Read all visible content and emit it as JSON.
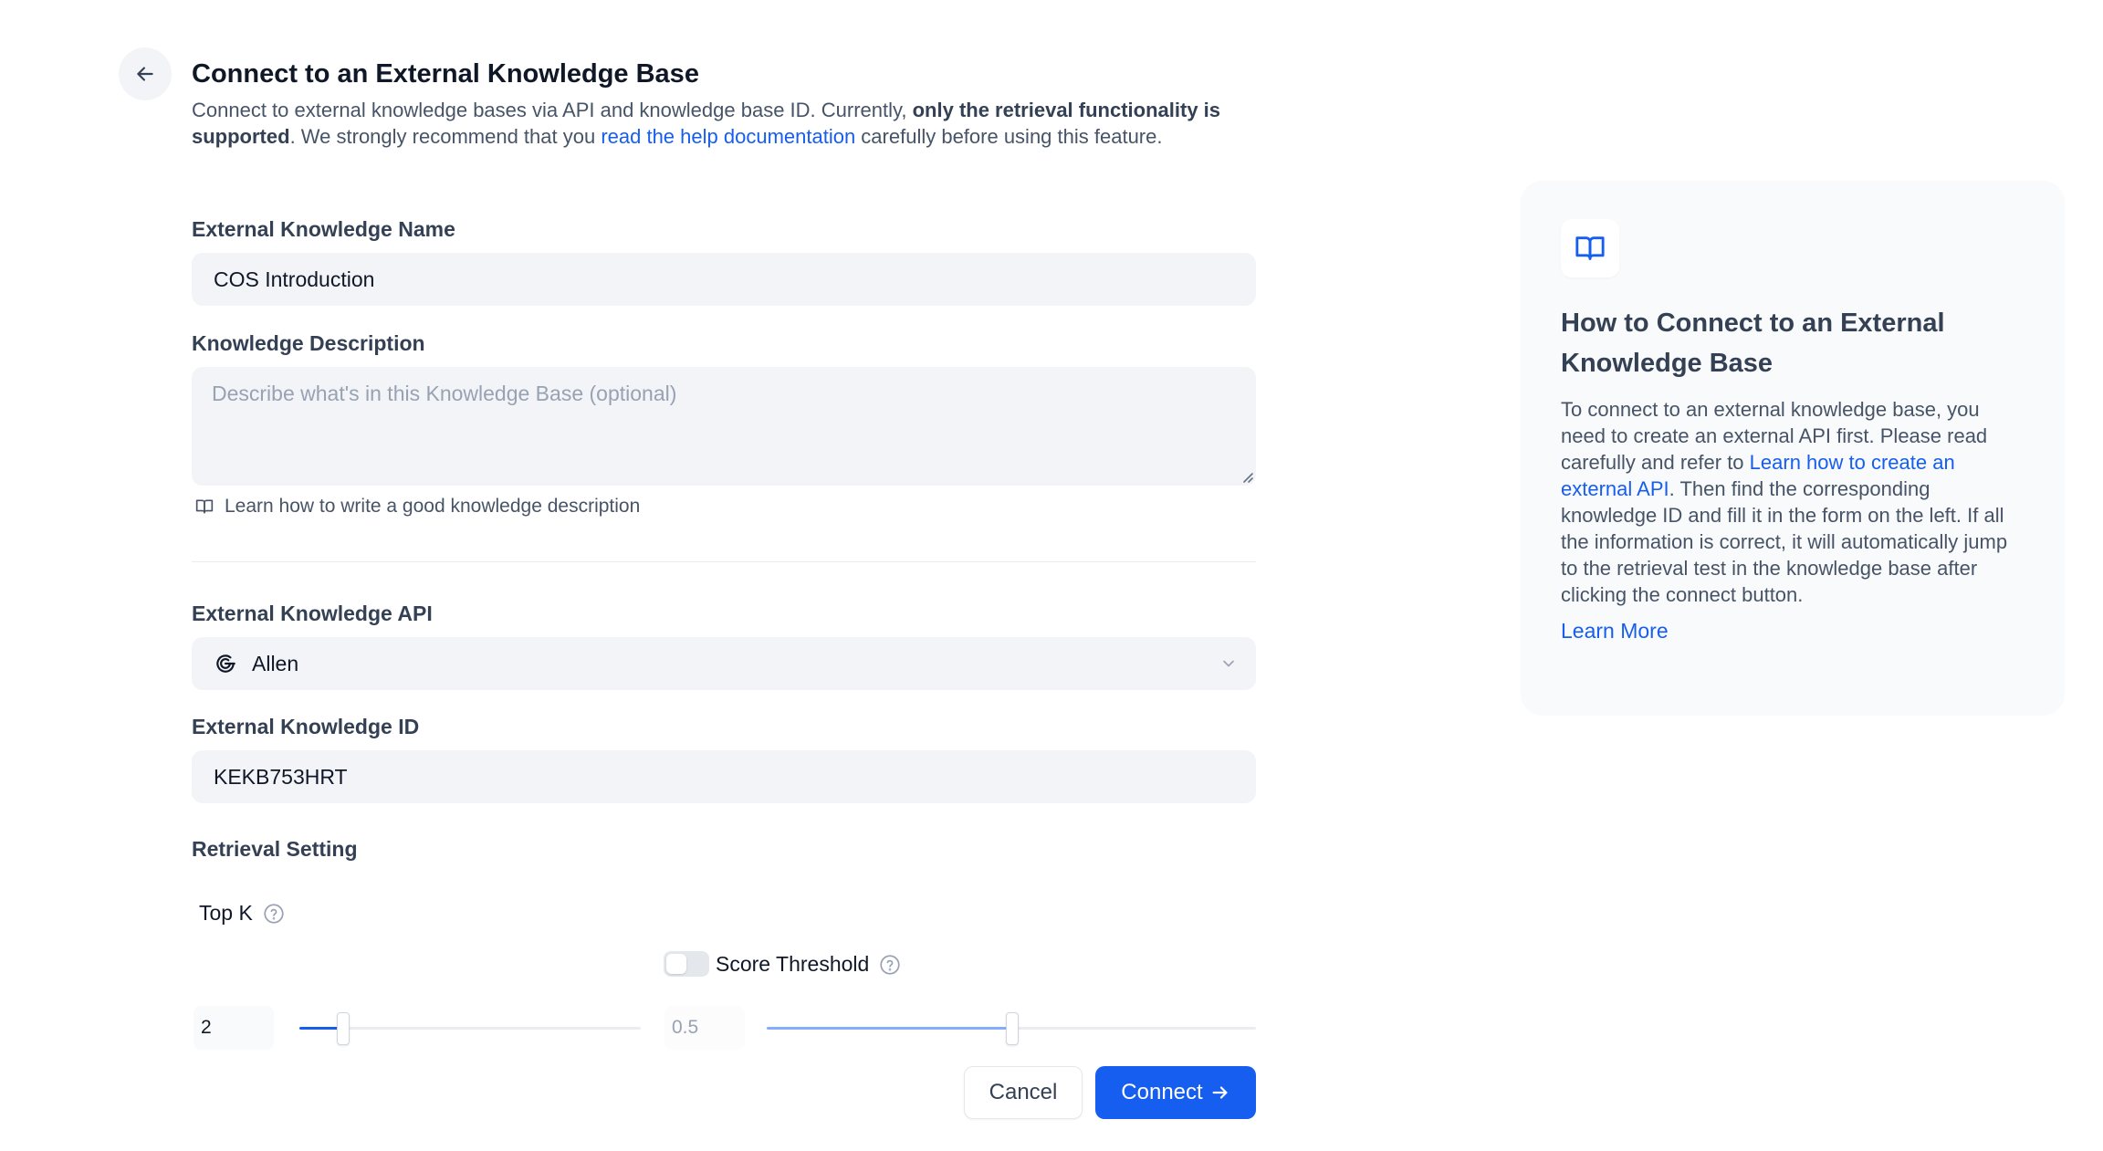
{
  "header": {
    "title": "Connect to an External Knowledge Base",
    "subtitle_part1": "Connect to external knowledge bases via API and knowledge base ID. Currently, ",
    "subtitle_bold": "only the retrieval functionality is supported",
    "subtitle_part2": ". We strongly recommend that you ",
    "subtitle_link": "read the help documentation",
    "subtitle_part3": " carefully before using this feature."
  },
  "form": {
    "name_label": "External Knowledge Name",
    "name_value": "COS Introduction",
    "description_label": "Knowledge Description",
    "description_placeholder": "Describe what's in this Knowledge Base (optional)",
    "description_hint": "Learn how to write a good knowledge description",
    "api_label": "External Knowledge API",
    "api_value": "Allen",
    "id_label": "External Knowledge ID",
    "id_value": "KEKB753HRT",
    "retrieval_label": "Retrieval Setting",
    "top_k_label": "Top K",
    "top_k_value": "2",
    "top_k_fraction": 0.125,
    "score_label": "Score Threshold",
    "score_value": "0.5",
    "score_fraction": 0.5,
    "score_enabled": false,
    "cancel_label": "Cancel",
    "connect_label": "Connect"
  },
  "panel": {
    "title": "How to Connect to an External Knowledge Base",
    "body_part1": "To connect to an external knowledge base, you need to create an external API first. Please read carefully and refer to ",
    "body_link": "Learn how to create an external API",
    "body_part2": ". Then find the corresponding knowledge ID and fill it in the form on the left. If all the information is correct, it will automatically jump to the retrieval test in the knowledge base after clicking the connect button.",
    "learn_more": "Learn More"
  },
  "colors": {
    "accent": "#155eef",
    "slider_fill_active": "#155eef",
    "slider_fill_disabled": "#84adff"
  },
  "icons": {
    "back": "arrow-left-icon",
    "book": "book-open-icon",
    "api": "api-connection-icon",
    "chevron": "chevron-down-icon",
    "help": "question-circle-icon",
    "connect_arrow": "arrow-right-icon"
  }
}
